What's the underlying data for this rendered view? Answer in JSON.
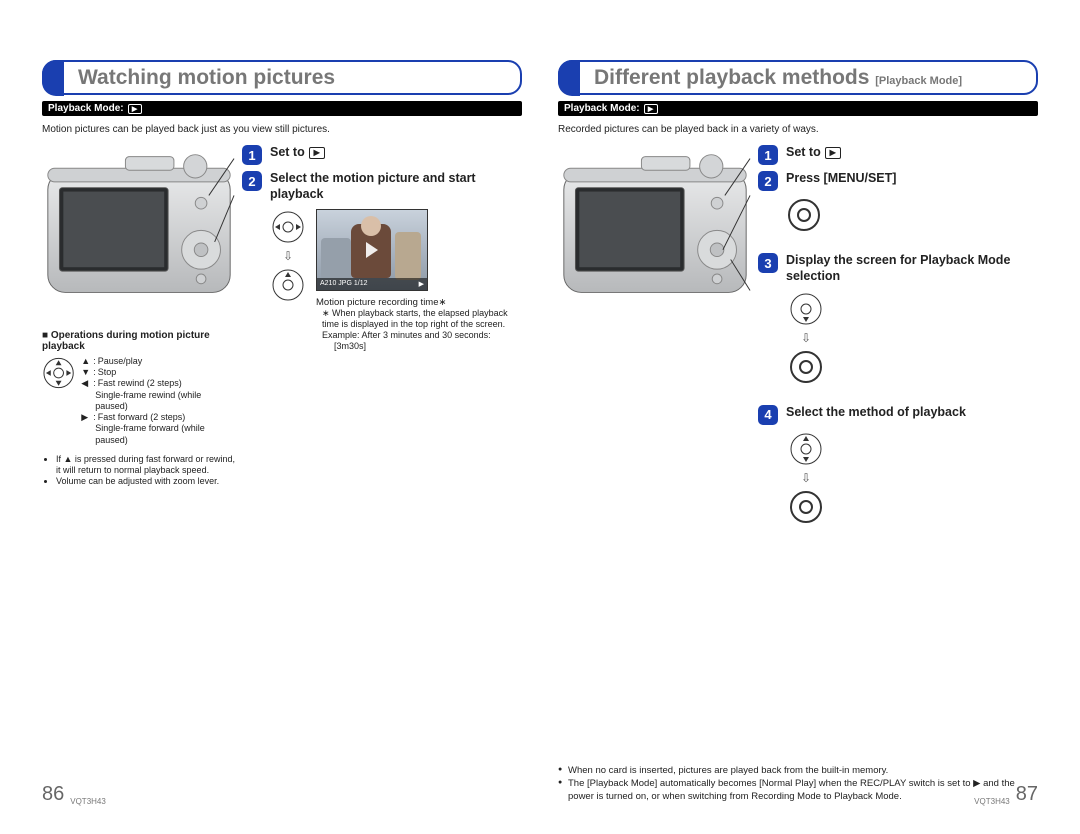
{
  "doc_id": "VQT3H43",
  "pages": {
    "left": "86",
    "right": "87"
  },
  "left": {
    "title": "Watching motion pictures",
    "mode_label": "Playback Mode:",
    "intro": "Motion pictures can be played back just as you view still pictures.",
    "steps": {
      "s1": "Set to",
      "s2": "Select the motion picture and start playback"
    },
    "thumb_bar_left": "A210  JPG   1/12",
    "thumb_bar_right": "▶",
    "rec_time_label": "Motion picture recording time∗",
    "rec_time_note_1": "∗ When playback starts, the elapsed playback time is displayed in the top right of the screen.",
    "rec_time_note_2": "Example: After 3 minutes and 30 seconds:",
    "rec_time_note_3": "[3m30s]",
    "ops_title": "■ Operations during motion picture playback",
    "ops": {
      "up": "Pause/play",
      "down": "Stop",
      "left1": "Fast rewind (2 steps)",
      "left2": "Single-frame rewind (while paused)",
      "right1": "Fast forward (2 steps)",
      "right2": "Single-frame forward (while paused)"
    },
    "bullets": [
      "If ▲ is pressed during fast forward or rewind, it will return to normal playback speed.",
      "Volume can be adjusted with zoom lever."
    ]
  },
  "right": {
    "title": "Different playback methods",
    "title_sub": "[Playback Mode]",
    "mode_label": "Playback Mode:",
    "intro": "Recorded pictures can be played back in a variety of ways.",
    "steps": {
      "s1": "Set to",
      "s2": "Press [MENU/SET]",
      "s3": "Display the screen for Playback Mode selection",
      "s4": "Select the method of playback"
    },
    "footnotes": [
      "When no card is inserted, pictures are played back from the built-in memory.",
      "The [Playback Mode] automatically becomes [Normal Play] when the REC/PLAY switch is set to ▶ and the power is turned on, or when switching from Recording Mode to Playback Mode."
    ]
  }
}
